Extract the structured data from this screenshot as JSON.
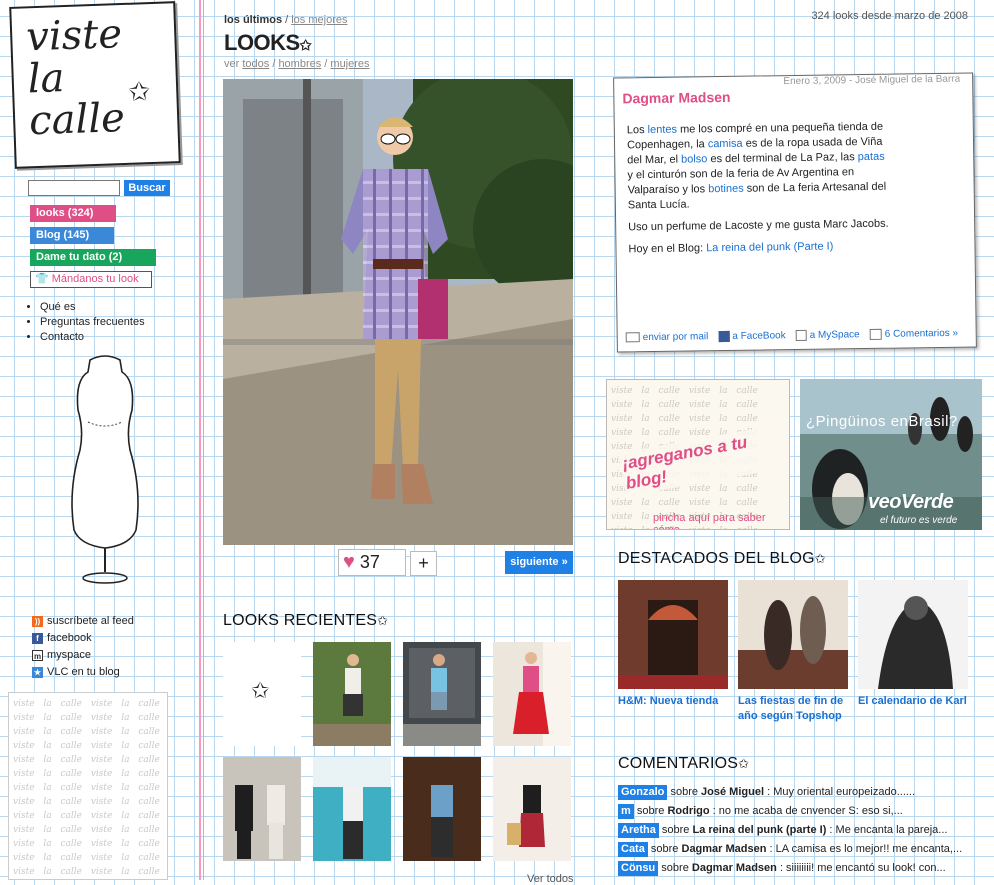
{
  "logo": {
    "line1": "viste",
    "line2": "la",
    "line3": "calle"
  },
  "search": {
    "placeholder": "",
    "button": "Buscar"
  },
  "sidebar": {
    "tabs": [
      {
        "label": "looks (324)",
        "color": "#e04e86"
      },
      {
        "label": "Blog (145)",
        "color": "#3b88d8"
      },
      {
        "label": "Dame tu dato (2)",
        "color": "#18a65c"
      },
      {
        "label": "Mándanos tu look",
        "color": "#e04e86"
      }
    ],
    "links": [
      "Qué es",
      "Preguntas frecuentes",
      "Contacto"
    ],
    "feeds": [
      {
        "label": "suscríbete al feed",
        "icon": "rss-icon"
      },
      {
        "label": "facebook",
        "icon": "facebook-icon"
      },
      {
        "label": "myspace",
        "icon": "myspace-icon"
      },
      {
        "label": "VLC en tu blog",
        "icon": "star-icon"
      }
    ],
    "pattern_text": "viste la calle"
  },
  "header": {
    "tab_active": "los últimos",
    "tab_separator": " / ",
    "tab_inactive": "los mejores",
    "count_text": "324 looks desde marzo de 2008",
    "title": "LOOKS",
    "filter_prefix": "ver",
    "filter_todos": "todos",
    "filter_hombres": "hombres",
    "filter_mujeres": "mujeres"
  },
  "look": {
    "likes": "37",
    "plus": "+",
    "next_label": "siguiente »"
  },
  "card": {
    "date_author": "Enero 3, 2009 - José Miguel de la Barra",
    "name": "Dagmar Madsen",
    "p1": [
      "Los ",
      "lentes",
      " me los compré en una pequeña tienda de Copenhagen, la ",
      "camisa",
      " es de la ropa usada de Viña del Mar, el ",
      "bolso",
      " es del terminal de La Paz, las ",
      "patas",
      " y el cinturón son de la feria de Av Argentina en Valparaíso y los ",
      "botines",
      " son de La feria Artesanal del Santa Lucía."
    ],
    "p2": "Uso un perfume de Lacoste y me gusta Marc Jacobs.",
    "p3_prefix": "Hoy en el Blog: ",
    "p3_link": "La reina del punk (Parte I)",
    "actions": [
      "enviar por mail",
      "a FaceBook",
      "a MySpace",
      "6 Comentarios »"
    ]
  },
  "ads": {
    "left_text": "¡agreganos a tu blog!",
    "left_sub": "pincha aquí para saber cómo",
    "right_title": "¿Pingüinos enBrasil?",
    "right_brand": "veoVerde",
    "right_tagline": "el futuro es verde"
  },
  "recent": {
    "title": "LOOKS RECIENTES",
    "ver_todos": "Ver todos"
  },
  "blog": {
    "title": "DESTACADOS DEL BLOG",
    "items": [
      {
        "caption": "H&M: Nueva tienda"
      },
      {
        "caption": "Las fiestas de fin de año según Topshop"
      },
      {
        "caption": "El calendario de Karl"
      }
    ]
  },
  "comments": {
    "title": "COMENTARIOS",
    "items": [
      {
        "who": "Gonzalo",
        "on": "José Miguel",
        "text": ": Muy oriental europeizado......"
      },
      {
        "who": "m",
        "on": "Rodrigo",
        "text": ": no me acaba de cnvencer S: eso si,..."
      },
      {
        "who": "Aretha",
        "on": "La reina del punk (parte I)",
        "text": ": Me encanta la pareja..."
      },
      {
        "who": "Cata",
        "on": "Dagmar Madsen",
        "text": ": LA camisa es lo mejor!! me encanta,..."
      },
      {
        "who": "Cönsu",
        "on": "Dagmar Madsen",
        "text": ": siiiiiiii! me encantó su look! con..."
      }
    ],
    "sobre": "sobre"
  }
}
